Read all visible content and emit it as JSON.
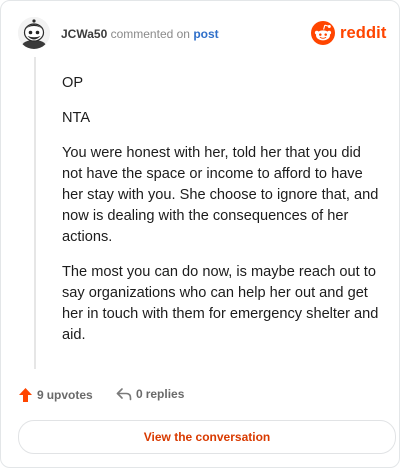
{
  "header": {
    "username": "JCWa50",
    "action_text": "commented on",
    "post_link": "post",
    "brand_name": "reddit"
  },
  "comment": {
    "paragraphs": [
      "OP",
      "NTA",
      "You were honest with her, told her that you did not have the space or income to afford to have her stay with you. She choose to ignore that, and now is dealing with the consequences of her actions.",
      "The most you can do now, is maybe reach out to say organizations who can help her out and get her in touch with them for emergency shelter and aid."
    ]
  },
  "footer": {
    "upvotes_count": "9",
    "upvotes_label": "upvotes",
    "replies_count": "0",
    "replies_label": "replies",
    "view_button_label": "View the conversation"
  },
  "colors": {
    "brand": "#ff4500",
    "link": "#2f6fc9",
    "cta": "#d93a00"
  },
  "icons": {
    "avatar": "snoo-avatar",
    "brand": "reddit-logo-icon",
    "upvote": "upvote-arrow-icon",
    "reply": "reply-arrow-icon"
  }
}
